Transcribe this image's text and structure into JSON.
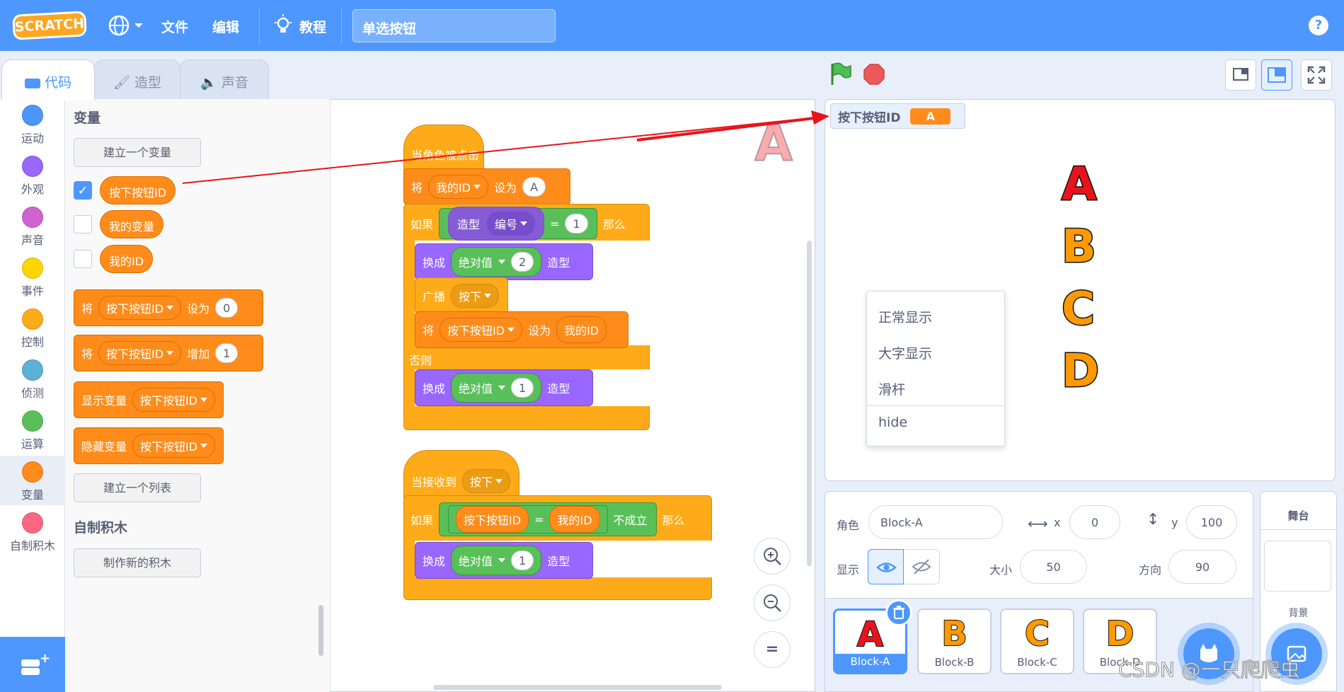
{
  "menubar": {
    "logo": "SCRATCH",
    "file": "文件",
    "edit": "编辑",
    "tutorials": "教程",
    "project_title": "单选按钮",
    "help": "?"
  },
  "tabs": {
    "code": "代码",
    "costumes": "造型",
    "sounds": "声音"
  },
  "categories": [
    "运动",
    "外观",
    "声音",
    "事件",
    "控制",
    "侦测",
    "运算",
    "变量",
    "自制积木"
  ],
  "category_colors": [
    "#4c97ff",
    "#9966ff",
    "#cf63cf",
    "#ffd500",
    "#ffab19",
    "#5cb1d6",
    "#59c059",
    "#ff8c1a",
    "#ff6680"
  ],
  "palette": {
    "variables_heading": "变量",
    "make_variable": "建立一个变量",
    "vars": [
      {
        "name": "按下按钮ID",
        "checked": true
      },
      {
        "name": "我的变量",
        "checked": false
      },
      {
        "name": "我的ID",
        "checked": false
      }
    ],
    "set_block": {
      "label": "将",
      "var": "按下按钮ID",
      "verb": "设为",
      "value": "0"
    },
    "change_block": {
      "label": "将",
      "var": "按下按钮ID",
      "verb": "增加",
      "value": "1"
    },
    "show_block": {
      "label": "显示变量",
      "var": "按下按钮ID"
    },
    "hide_block": {
      "label": "隐藏变量",
      "var": "按下按钮ID"
    },
    "make_list": "建立一个列表",
    "myblocks_heading": "自制积木",
    "make_block": "制作新的积木"
  },
  "script1": {
    "hat": "当角色被点击",
    "set": {
      "label": "将",
      "var": "我的ID",
      "verb": "设为",
      "value": "A"
    },
    "if": "如果",
    "costume": "造型",
    "costume_prop": "编号",
    "eq": "=",
    "eq_val": "1",
    "then": "那么",
    "switch1": {
      "label": "换成",
      "op": "绝对值",
      "value": "2",
      "tail": "造型"
    },
    "broadcast": {
      "label": "广播",
      "msg": "按下"
    },
    "set2": {
      "label": "将",
      "var": "按下按钮ID",
      "verb": "设为",
      "value": "我的ID"
    },
    "else": "否则",
    "switch2": {
      "label": "换成",
      "op": "绝对值",
      "value": "1",
      "tail": "造型"
    }
  },
  "script2": {
    "hat": "当接收到",
    "msg": "按下",
    "if": "如果",
    "var": "按下按钮ID",
    "eq": "=",
    "rhs": "我的ID",
    "not": "不成立",
    "then": "那么",
    "switch": {
      "label": "换成",
      "op": "绝对值",
      "value": "1",
      "tail": "造型"
    }
  },
  "sprite_watermark": "A",
  "zoom": {
    "in": "+",
    "out": "−",
    "reset": "="
  },
  "stage": {
    "monitor_label": "按下按钮ID",
    "monitor_value": "A",
    "letters": [
      "A",
      "B",
      "C",
      "D"
    ],
    "letter_colors": [
      "#e8141c",
      "#ff9900",
      "#ff9900",
      "#ff9900"
    ],
    "context_menu": [
      "正常显示",
      "大字显示",
      "滑杆",
      "hide"
    ]
  },
  "sprite_info": {
    "sprite_label": "角色",
    "sprite_name": "Block-A",
    "x_label": "x",
    "x": "0",
    "y_label": "y",
    "y": "100",
    "show_label": "显示",
    "size_label": "大小",
    "size": "50",
    "direction_label": "方向",
    "direction": "90"
  },
  "sprites": [
    {
      "name": "Block-A",
      "letter": "A",
      "color": "#e8141c",
      "selected": true
    },
    {
      "name": "Block-B",
      "letter": "B",
      "color": "#ff9900",
      "selected": false
    },
    {
      "name": "Block-C",
      "letter": "C",
      "color": "#ff9900",
      "selected": false
    },
    {
      "name": "Block-D",
      "letter": "D",
      "color": "#ff9900",
      "selected": false
    }
  ],
  "stage_selector": {
    "title": "舞台",
    "backdrop": "背景"
  },
  "watermark": "CSDN @一只爬爬虫"
}
